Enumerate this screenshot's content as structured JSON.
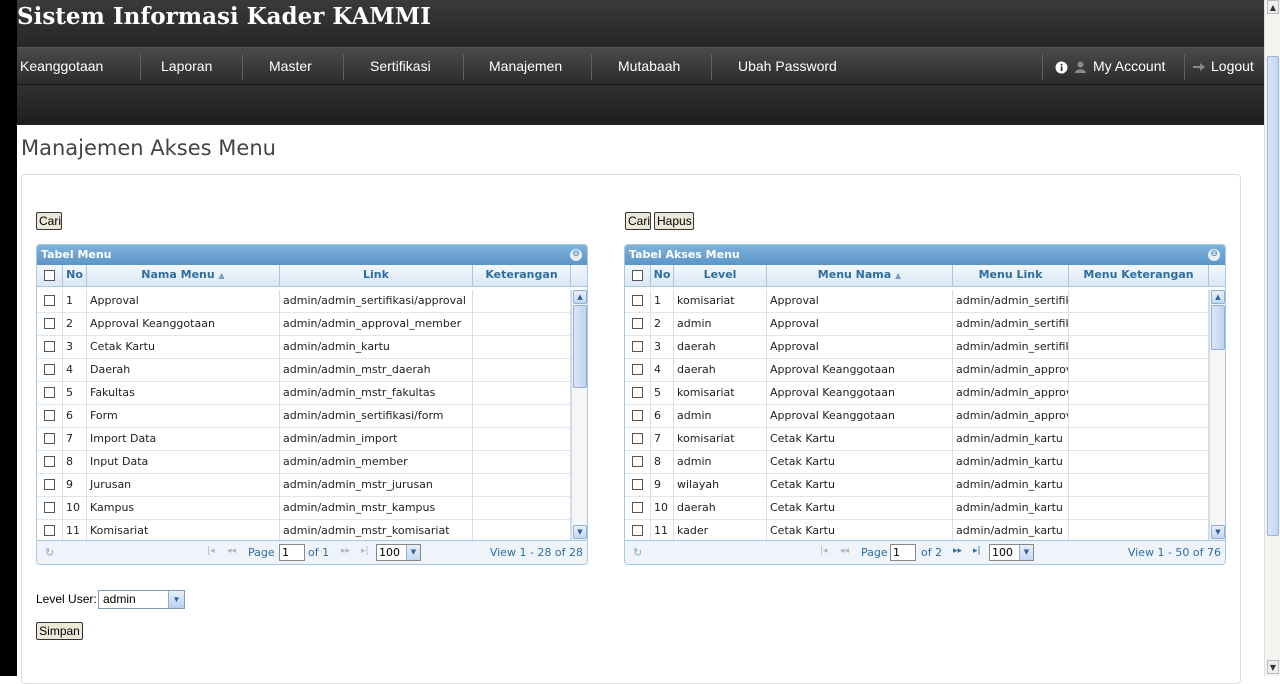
{
  "app": {
    "title": "Sistem Informasi Kader KAMMI"
  },
  "nav": {
    "items": [
      "Keanggotaan",
      "Laporan",
      "Master",
      "Sertifikasi",
      "Manajemen",
      "Mutabaah",
      "Ubah Password"
    ],
    "account_label": "My Account",
    "logout_label": "Logout"
  },
  "page": {
    "title": "Manajemen Akses Menu"
  },
  "menu_panel": {
    "cari_label": "Cari",
    "caption": "Tabel Menu",
    "columns": [
      "No",
      "Nama Menu",
      "Link",
      "Keterangan"
    ],
    "sort_indicator": "▲",
    "rows": [
      {
        "no": "1",
        "nama": "Approval",
        "link": "admin/admin_sertifikasi/approval",
        "ket": ""
      },
      {
        "no": "2",
        "nama": "Approval Keanggotaan",
        "link": "admin/admin_approval_member",
        "ket": ""
      },
      {
        "no": "3",
        "nama": "Cetak Kartu",
        "link": "admin/admin_kartu",
        "ket": ""
      },
      {
        "no": "4",
        "nama": "Daerah",
        "link": "admin/admin_mstr_daerah",
        "ket": ""
      },
      {
        "no": "5",
        "nama": "Fakultas",
        "link": "admin/admin_mstr_fakultas",
        "ket": ""
      },
      {
        "no": "6",
        "nama": "Form",
        "link": "admin/admin_sertifikasi/form",
        "ket": ""
      },
      {
        "no": "7",
        "nama": "Import Data",
        "link": "admin/admin_import",
        "ket": ""
      },
      {
        "no": "8",
        "nama": "Input Data",
        "link": "admin/admin_member",
        "ket": ""
      },
      {
        "no": "9",
        "nama": "Jurusan",
        "link": "admin/admin_mstr_jurusan",
        "ket": ""
      },
      {
        "no": "10",
        "nama": "Kampus",
        "link": "admin/admin_mstr_kampus",
        "ket": ""
      },
      {
        "no": "11",
        "nama": "Komisariat",
        "link": "admin/admin_mstr_komisariat",
        "ket": ""
      }
    ],
    "pager": {
      "page_label": "Page",
      "page_value": "1",
      "of_label": "of 1",
      "rows_per_page": "100",
      "view_text": "View 1 - 28 of 28"
    }
  },
  "akses_panel": {
    "cari_label": "Cari",
    "hapus_label": "Hapus",
    "caption": "Tabel Akses Menu",
    "columns": [
      "No",
      "Level",
      "Menu Nama",
      "Menu Link",
      "Menu Keterangan"
    ],
    "sort_indicator": "▲",
    "rows": [
      {
        "no": "1",
        "level": "komisariat",
        "menu": "Approval",
        "link": "admin/admin_sertifik",
        "ket": ""
      },
      {
        "no": "2",
        "level": "admin",
        "menu": "Approval",
        "link": "admin/admin_sertifik",
        "ket": ""
      },
      {
        "no": "3",
        "level": "daerah",
        "menu": "Approval",
        "link": "admin/admin_sertifik",
        "ket": ""
      },
      {
        "no": "4",
        "level": "daerah",
        "menu": "Approval Keanggotaan",
        "link": "admin/admin_approv",
        "ket": ""
      },
      {
        "no": "5",
        "level": "komisariat",
        "menu": "Approval Keanggotaan",
        "link": "admin/admin_approv",
        "ket": ""
      },
      {
        "no": "6",
        "level": "admin",
        "menu": "Approval Keanggotaan",
        "link": "admin/admin_approv",
        "ket": ""
      },
      {
        "no": "7",
        "level": "komisariat",
        "menu": "Cetak Kartu",
        "link": "admin/admin_kartu",
        "ket": ""
      },
      {
        "no": "8",
        "level": "admin",
        "menu": "Cetak Kartu",
        "link": "admin/admin_kartu",
        "ket": ""
      },
      {
        "no": "9",
        "level": "wilayah",
        "menu": "Cetak Kartu",
        "link": "admin/admin_kartu",
        "ket": ""
      },
      {
        "no": "10",
        "level": "daerah",
        "menu": "Cetak Kartu",
        "link": "admin/admin_kartu",
        "ket": ""
      },
      {
        "no": "11",
        "level": "kader",
        "menu": "Cetak Kartu",
        "link": "admin/admin_kartu",
        "ket": ""
      }
    ],
    "pager": {
      "page_label": "Page",
      "page_value": "1",
      "of_label": "of 2",
      "rows_per_page": "100",
      "view_text": "View 1 - 50 of 76"
    }
  },
  "level_user": {
    "label": "Level User:",
    "value": "admin"
  },
  "simpan_label": "Simpan",
  "colors": {
    "header_bg": "#2a2a2a",
    "grid_caption": "#5b96c8",
    "grid_header_text": "#2e6e9e"
  }
}
